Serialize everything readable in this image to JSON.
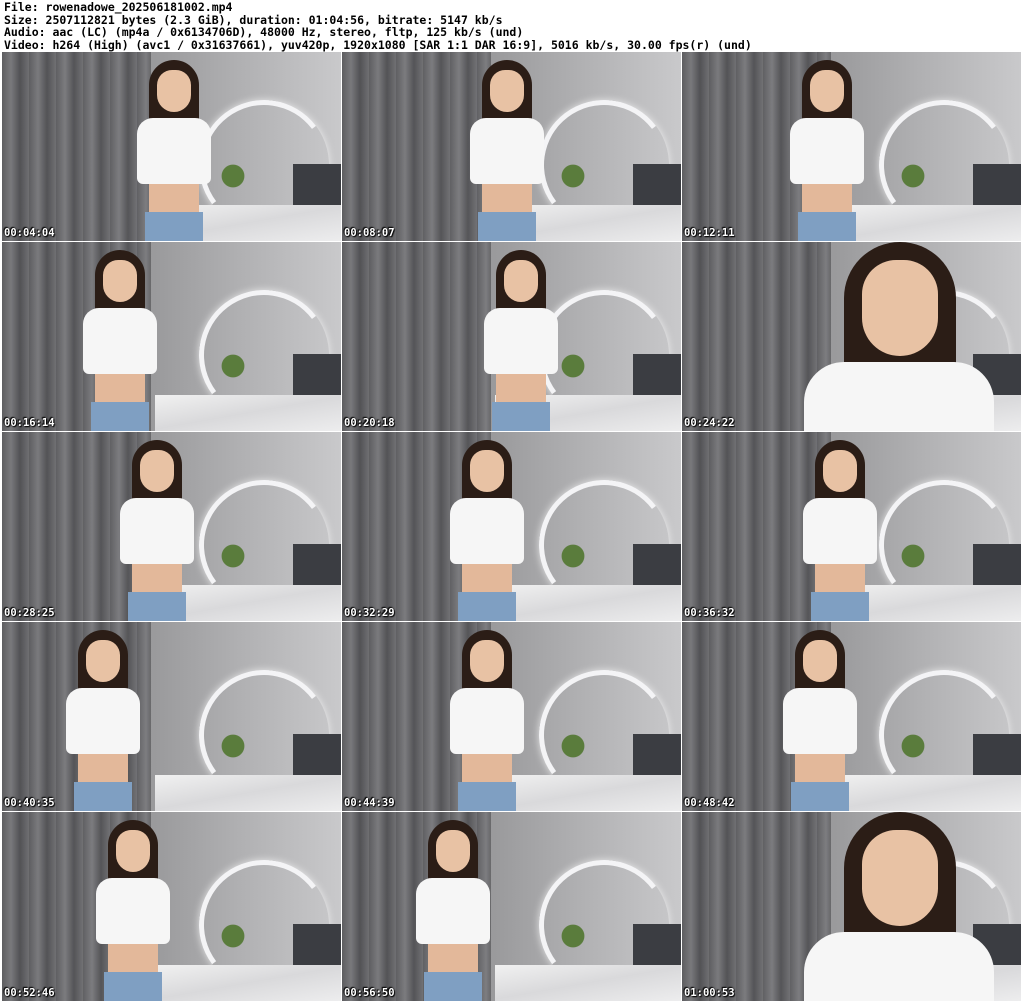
{
  "header": {
    "file_line": "File: rowenadowe_202506181002.mp4",
    "size_line": "Size: 2507112821 bytes (2.3 GiB), duration: 01:04:56, bitrate: 5147 kb/s",
    "audio_line": "Audio: aac (LC) (mp4a / 0x6134706D), 48000 Hz, stereo, fltp, 125 kb/s (und)",
    "video_line": "Video: h264 (High) (avc1 / 0x31637661), yuv420p, 1920x1080 [SAR 1:1 DAR 16:9], 5016 kb/s, 30.00 fps(r) (und)"
  },
  "thumbnails": [
    {
      "timestamp": "00:04:04"
    },
    {
      "timestamp": "00:08:07"
    },
    {
      "timestamp": "00:12:11"
    },
    {
      "timestamp": "00:16:14"
    },
    {
      "timestamp": "00:20:18"
    },
    {
      "timestamp": "00:24:22"
    },
    {
      "timestamp": "00:28:25"
    },
    {
      "timestamp": "00:32:29"
    },
    {
      "timestamp": "00:36:32"
    },
    {
      "timestamp": "00:40:35"
    },
    {
      "timestamp": "00:44:39"
    },
    {
      "timestamp": "00:48:42"
    },
    {
      "timestamp": "00:52:46"
    },
    {
      "timestamp": "00:56:50"
    },
    {
      "timestamp": "01:00:53"
    }
  ],
  "colors": {
    "background": "#ffffff",
    "header_text": "#000000",
    "timestamp_text": "#ffffff",
    "shirt": "#f6f6f6",
    "jeans": "#7f9fc2"
  }
}
